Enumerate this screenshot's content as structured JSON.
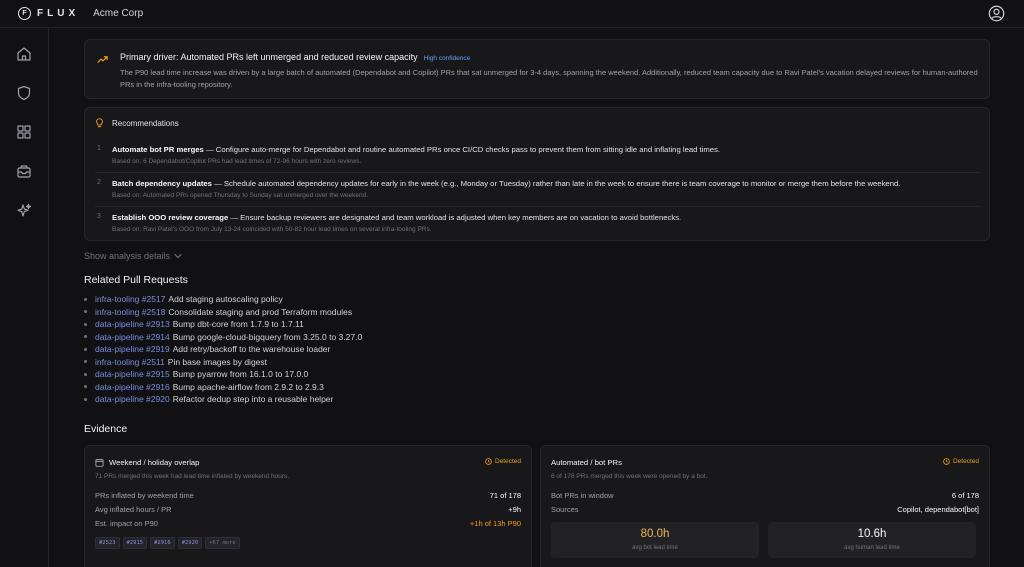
{
  "header": {
    "logo_mark": "F",
    "logo_text": "FLUX",
    "org_name": "Acme Corp"
  },
  "sidebar": {
    "icons": [
      "home-icon",
      "shield-icon",
      "grid-icon",
      "inbox-icon",
      "sparkle-icon"
    ]
  },
  "driver": {
    "title": "Primary driver: Automated PRs left unmerged and reduced review capacity",
    "confidence": "High confidence",
    "text": "The P90 lead time increase was driven by a large batch of automated (Dependabot and Copilot) PRs that sat unmerged for 3-4 days, spanning the weekend. Additionally, reduced team capacity due to Ravi Patel's vacation delayed reviews for human-authored PRs in the infra-tooling repository."
  },
  "recommendations": {
    "heading": "Recommendations",
    "items": [
      {
        "num": "1",
        "title": "Automate bot PR merges",
        "text": " — Configure auto-merge for Dependabot and routine automated PRs once CI/CD checks pass to prevent them from sitting idle and inflating lead times.",
        "based": "Based on: 6 Dependabot/Copilot PRs had lead times of 72-96 hours with zero reviews."
      },
      {
        "num": "2",
        "title": "Batch dependency updates",
        "text": " — Schedule automated dependency updates for early in the week (e.g., Monday or Tuesday) rather than late in the week to ensure there is team coverage to monitor or merge them before the weekend.",
        "based": "Based on: Automated PRs opened Thursday to Sunday sat unmerged over the weekend."
      },
      {
        "num": "3",
        "title": "Establish OOO review coverage",
        "text": " — Ensure backup reviewers are designated and team workload is adjusted when key members are on vacation to avoid bottlenecks.",
        "based": "Based on: Ravi Patel's OOO from July 13-24 coincided with 50-82 hour lead times on several infra-tooling PRs."
      }
    ]
  },
  "show_details": "Show analysis details",
  "related": {
    "heading": "Related Pull Requests",
    "items": [
      {
        "link": "infra-tooling #2517",
        "title": "Add staging autoscaling policy"
      },
      {
        "link": "infra-tooling #2518",
        "title": "Consolidate staging and prod Terraform modules"
      },
      {
        "link": "data-pipeline #2913",
        "title": "Bump dbt-core from 1.7.9 to 1.7.11"
      },
      {
        "link": "data-pipeline #2914",
        "title": "Bump google-cloud-bigquery from 3.25.0 to 3.27.0"
      },
      {
        "link": "data-pipeline #2919",
        "title": "Add retry/backoff to the warehouse loader"
      },
      {
        "link": "infra-tooling #2511",
        "title": "Pin base images by digest"
      },
      {
        "link": "data-pipeline #2915",
        "title": "Bump pyarrow from 16.1.0 to 17.0.0"
      },
      {
        "link": "data-pipeline #2916",
        "title": "Bump apache-airflow from 2.9.2 to 2.9.3"
      },
      {
        "link": "data-pipeline #2920",
        "title": "Refactor dedup step into a reusable helper"
      }
    ]
  },
  "evidence": {
    "heading": "Evidence",
    "weekend": {
      "title": "Weekend / holiday overlap",
      "status": "Detected",
      "subtitle": "71 PRs merged this week had lead time inflated by weekend hours.",
      "rows": [
        {
          "label": "PRs inflated by weekend time",
          "value": "71 of 178"
        },
        {
          "label": "Avg inflated hours / PR",
          "value": "+9h"
        },
        {
          "label": "Est. impact on P90",
          "value": "+1h of 13h P90"
        }
      ],
      "tags": [
        "#2523",
        "#2915",
        "#2916",
        "#2920",
        "+67 more"
      ]
    },
    "bots": {
      "title": "Automated / bot PRs",
      "status": "Detected",
      "subtitle": "6 of 178 PRs merged this week were opened by a bot.",
      "rows": [
        {
          "label": "Bot PRs in window",
          "value": "6 of 178"
        },
        {
          "label": "Sources",
          "value": "Copilot, dependabot[bot]"
        }
      ],
      "stats": [
        {
          "value": "80.0h",
          "label": "avg bot lead time"
        },
        {
          "value": "10.6h",
          "label": "avg human lead time"
        }
      ]
    }
  },
  "colors": {
    "accent_link": "#7c8ce0",
    "detected": "#f59e0b",
    "confidence": "#60a5fa"
  }
}
